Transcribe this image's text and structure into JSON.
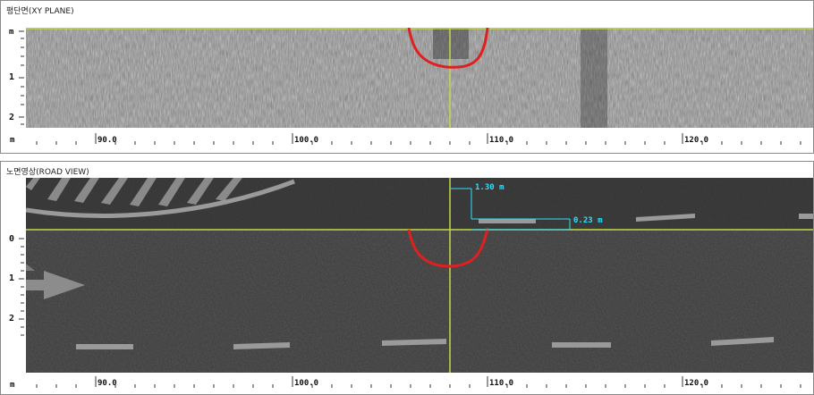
{
  "xy_panel": {
    "title": "평단면(XY PLANE)",
    "vertical_unit": "m",
    "vertical_ticks": [
      "1",
      "2"
    ],
    "horizontal_unit": "m",
    "horizontal_ticks": [
      "90.0",
      "100.0",
      "110.0",
      "120.0"
    ]
  },
  "road_panel": {
    "title": "노면영상(ROAD VIEW)",
    "vertical_ticks": [
      "0",
      "1",
      "2"
    ],
    "horizontal_unit": "m",
    "horizontal_ticks": [
      "90.0",
      "100.0",
      "110.0",
      "120.0"
    ],
    "measurement_vertical": "1.30 m",
    "measurement_horizontal": "0.23 m"
  },
  "colors": {
    "cursor": "#c8d84a",
    "anomaly_outline": "#e02020",
    "measurement": "#2ee0ff"
  }
}
